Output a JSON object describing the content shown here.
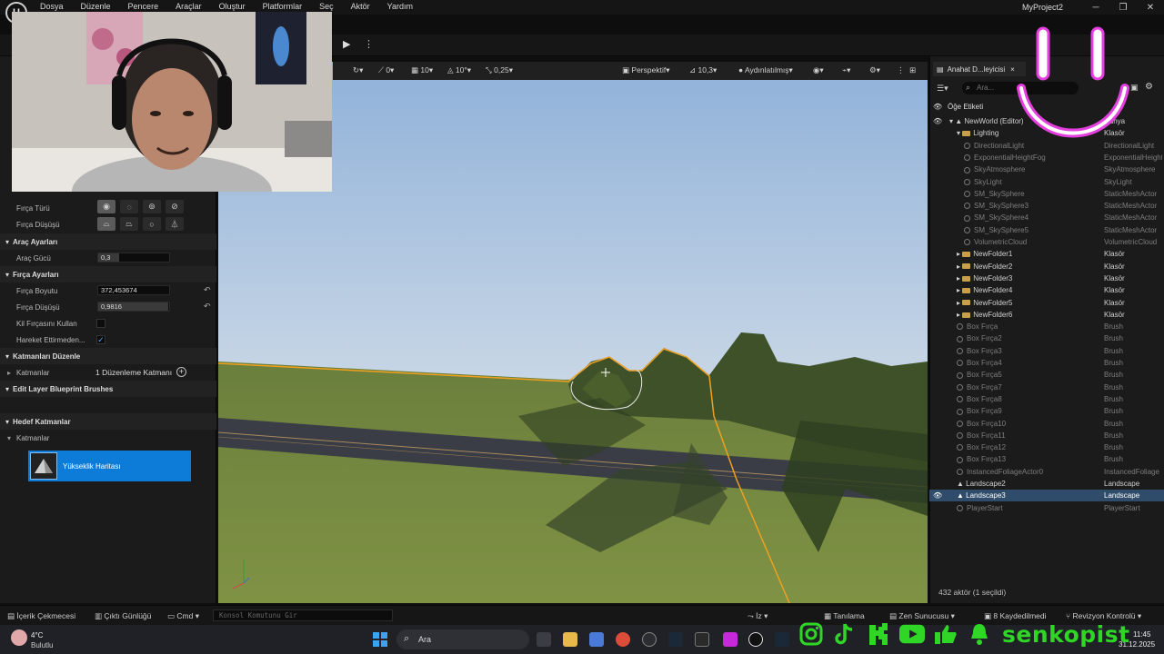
{
  "menubar": {
    "logo": "U",
    "items": [
      "Dosya",
      "Düzenle",
      "Pencere",
      "Araçlar",
      "Oluştur",
      "Platformlar",
      "Seç",
      "Aktör",
      "Yardım"
    ],
    "project_name": "MyProject2"
  },
  "left_panel": {
    "brush_type_label": "Fırça Türü",
    "brush_falloff_label": "Fırça Düşüşü",
    "tool_settings_header": "Araç Ayarları",
    "tool_strength_label": "Araç Gücü",
    "tool_strength_value": "0,3",
    "tool_strength_fraction": 0.3,
    "brush_settings_header": "Fırça Ayarları",
    "brush_size_label": "Fırça Boyutu",
    "brush_size_value": "372,453674",
    "brush_falloff_value_label": "Fırça Düşüşü",
    "brush_falloff_value": "0,9816",
    "brush_falloff_fraction": 0.9816,
    "clay_brush_label": "Kil Fırçasını Kullan",
    "clay_brush_checked": false,
    "no_move_label": "Hareket Ettirmeden...",
    "no_move_checked": true,
    "edit_layers_header": "Katmanları Düzenle",
    "layers_label": "Katmanlar",
    "layers_value": "1 Düzenleme Katmanı",
    "blueprint_brushes_header": "Edit Layer Blueprint Brushes",
    "target_layers_header": "Hedef Katmanlar",
    "target_layers_label": "Katmanlar",
    "heightmap_label": "Yükseklik Haritası"
  },
  "viewport_toolbar": {
    "rotate_snap": "0",
    "grid_snap": "10",
    "angle_snap": "10°",
    "scale_snap": "0,25",
    "view_mode": "Perspektif",
    "fov": "10,3",
    "lighting_mode": "Aydınlatılmış"
  },
  "outliner": {
    "tab_label": "Anahat D...leyicisi",
    "search_placeholder": "Ara...",
    "column_label": "Öğe Etiketi",
    "rows": [
      {
        "name": "NewWorld (Editor)",
        "type": "Dünya",
        "indent": 2,
        "kind": "world",
        "dim": false
      },
      {
        "name": "Lighting",
        "type": "Klasör",
        "indent": 3,
        "kind": "folder",
        "dim": false
      },
      {
        "name": "DirectionalLight",
        "type": "DirectionalLight",
        "indent": 4,
        "kind": "actor",
        "dim": true
      },
      {
        "name": "ExponentialHeightFog",
        "type": "ExponentialHeightFog",
        "indent": 4,
        "kind": "actor",
        "dim": true
      },
      {
        "name": "SkyAtmosphere",
        "type": "SkyAtmosphere",
        "indent": 4,
        "kind": "actor",
        "dim": true
      },
      {
        "name": "SkyLight",
        "type": "SkyLight",
        "indent": 4,
        "kind": "actor",
        "dim": true
      },
      {
        "name": "SM_SkySphere",
        "type": "StaticMeshActor",
        "indent": 4,
        "kind": "actor",
        "dim": true
      },
      {
        "name": "SM_SkySphere3",
        "type": "StaticMeshActor",
        "indent": 4,
        "kind": "actor",
        "dim": true
      },
      {
        "name": "SM_SkySphere4",
        "type": "StaticMeshActor",
        "indent": 4,
        "kind": "actor",
        "dim": true
      },
      {
        "name": "SM_SkySphere5",
        "type": "StaticMeshActor",
        "indent": 4,
        "kind": "actor",
        "dim": true
      },
      {
        "name": "VolumetricCloud",
        "type": "VolumetricCloud",
        "indent": 4,
        "kind": "actor",
        "dim": true
      },
      {
        "name": "NewFolder1",
        "type": "Klasör",
        "indent": 3,
        "kind": "folder-collapsed",
        "dim": false
      },
      {
        "name": "NewFolder2",
        "type": "Klasör",
        "indent": 3,
        "kind": "folder-collapsed",
        "dim": false
      },
      {
        "name": "NewFolder3",
        "type": "Klasör",
        "indent": 3,
        "kind": "folder-collapsed",
        "dim": false
      },
      {
        "name": "NewFolder4",
        "type": "Klasör",
        "indent": 3,
        "kind": "folder-collapsed",
        "dim": false
      },
      {
        "name": "NewFolder5",
        "type": "Klasör",
        "indent": 3,
        "kind": "folder-collapsed",
        "dim": false
      },
      {
        "name": "NewFolder6",
        "type": "Klasör",
        "indent": 3,
        "kind": "folder-collapsed",
        "dim": false
      },
      {
        "name": "Box Fırça",
        "type": "Brush",
        "indent": 3,
        "kind": "brush",
        "dim": true
      },
      {
        "name": "Box Fırça2",
        "type": "Brush",
        "indent": 3,
        "kind": "brush",
        "dim": true
      },
      {
        "name": "Box Fırça3",
        "type": "Brush",
        "indent": 3,
        "kind": "brush",
        "dim": true
      },
      {
        "name": "Box Fırça4",
        "type": "Brush",
        "indent": 3,
        "kind": "brush",
        "dim": true
      },
      {
        "name": "Box Fırça5",
        "type": "Brush",
        "indent": 3,
        "kind": "brush",
        "dim": true
      },
      {
        "name": "Box Fırça7",
        "type": "Brush",
        "indent": 3,
        "kind": "brush",
        "dim": true
      },
      {
        "name": "Box Fırça8",
        "type": "Brush",
        "indent": 3,
        "kind": "brush",
        "dim": true
      },
      {
        "name": "Box Fırça9",
        "type": "Brush",
        "indent": 3,
        "kind": "brush",
        "dim": true
      },
      {
        "name": "Box Fırça10",
        "type": "Brush",
        "indent": 3,
        "kind": "brush",
        "dim": true
      },
      {
        "name": "Box Fırça11",
        "type": "Brush",
        "indent": 3,
        "kind": "brush",
        "dim": true
      },
      {
        "name": "Box Fırça12",
        "type": "Brush",
        "indent": 3,
        "kind": "brush",
        "dim": true
      },
      {
        "name": "Box Fırça13",
        "type": "Brush",
        "indent": 3,
        "kind": "brush",
        "dim": true
      },
      {
        "name": "InstancedFoliageActor0",
        "type": "InstancedFoliage",
        "indent": 3,
        "kind": "actor",
        "dim": true
      },
      {
        "name": "Landscape2",
        "type": "Landscape",
        "indent": 3,
        "kind": "landscape",
        "dim": false
      },
      {
        "name": "Landscape3",
        "type": "Landscape",
        "indent": 3,
        "kind": "landscape",
        "dim": false,
        "selected": true
      },
      {
        "name": "PlayerStart",
        "type": "PlayerStart",
        "indent": 3,
        "kind": "actor",
        "dim": true
      }
    ],
    "footer": "432 aktör (1 seçildi)"
  },
  "statusbar": {
    "content_drawer": "İçerik Çekmecesi",
    "output_log": "Çıktı Günlüğü",
    "cmd": "Cmd",
    "console_placeholder": "Konsol Komutunu Gir",
    "trace": "İz",
    "derived_data": "Tanılama",
    "zen_server": "Zen Sunucusu",
    "unsaved": "8 Kaydedilmedi",
    "revision_control": "Revizyon Kontrolü"
  },
  "taskbar": {
    "weather_temp": "4°C",
    "weather_desc": "Bulutlu",
    "search_placeholder": "Ara",
    "time": "11:45",
    "date": "31.12.2025"
  },
  "overlay": {
    "channel_name": "senkopist",
    "social_icons": [
      "instagram-icon",
      "tiktok-icon",
      "kick-icon",
      "youtube-icon",
      "like-icon",
      "notification-bell-icon"
    ],
    "accent_color": "#2fd626",
    "smile_color": "#e53fe0"
  }
}
